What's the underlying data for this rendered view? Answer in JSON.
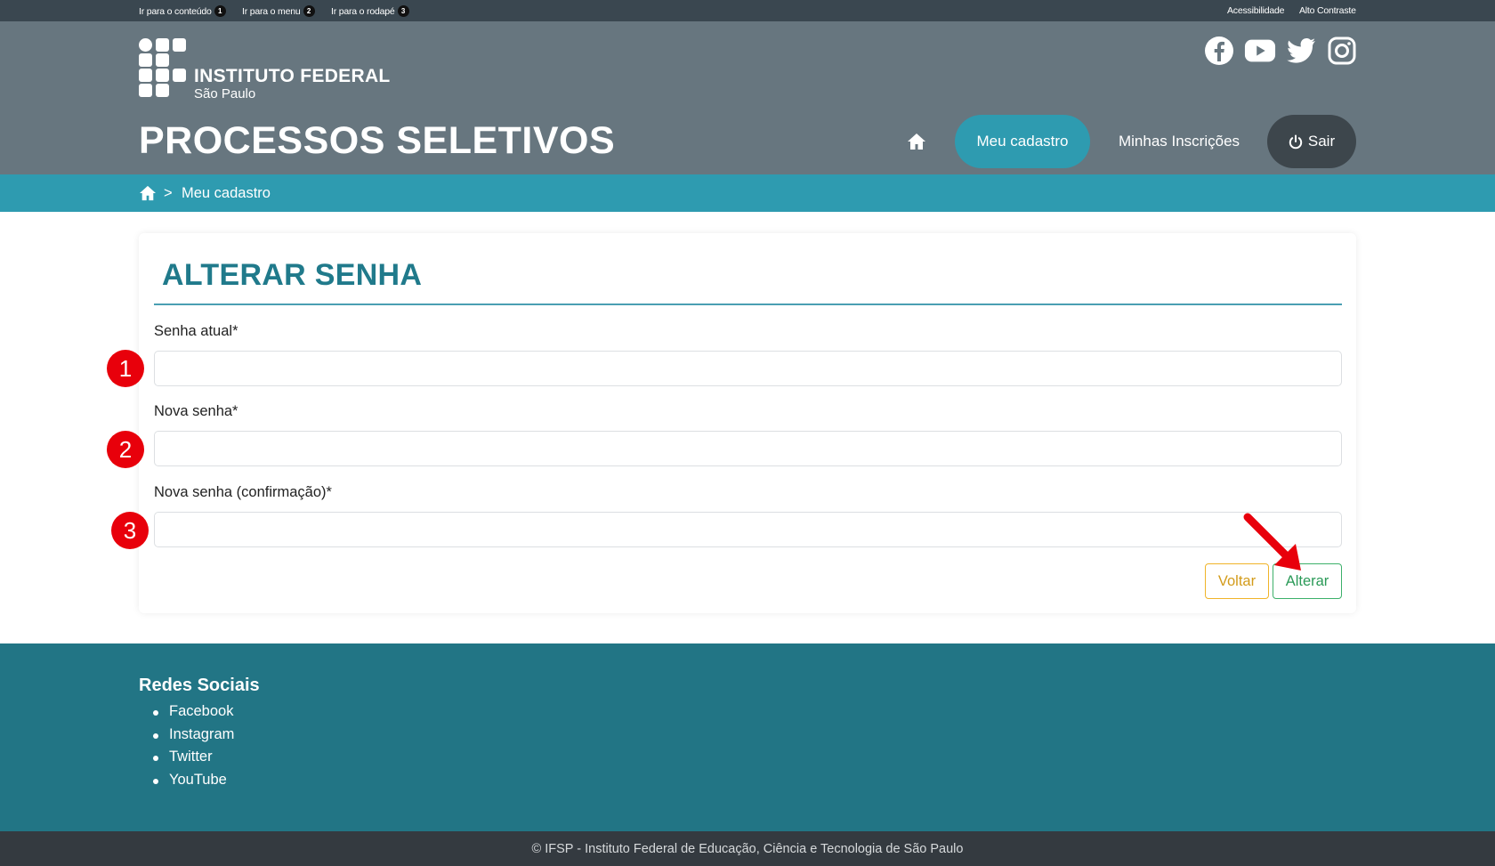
{
  "topbar": {
    "skip_links": [
      {
        "label": "Ir para o conteúdo",
        "key": "1"
      },
      {
        "label": "Ir para o menu",
        "key": "2"
      },
      {
        "label": "Ir para o rodapé",
        "key": "3"
      }
    ],
    "accessibility_label": "Acessibilidade",
    "contrast_label": "Alto Contraste"
  },
  "header": {
    "institution_name": "INSTITUTO FEDERAL",
    "institution_campus": "São Paulo",
    "site_title": "PROCESSOS SELETIVOS",
    "social_icons": [
      "facebook-icon",
      "youtube-icon",
      "twitter-icon",
      "instagram-icon"
    ],
    "nav": {
      "home_icon": "home-icon",
      "items": [
        "Meu cadastro",
        "Minhas Inscrições"
      ],
      "active": "Meu cadastro",
      "logout_label": "Sair",
      "logout_icon": "power-icon"
    }
  },
  "breadcrumb": {
    "home_icon": "home-icon",
    "separator": ">",
    "current": "Meu cadastro"
  },
  "form": {
    "title": "ALTERAR SENHA",
    "fields": [
      {
        "label": "Senha atual*",
        "value": "",
        "marker": "1"
      },
      {
        "label": "Nova senha*",
        "value": "",
        "marker": "2"
      },
      {
        "label": "Nova senha (confirmação)*",
        "value": "",
        "marker": "3"
      }
    ],
    "back_button": "Voltar",
    "submit_button": "Alterar"
  },
  "footer": {
    "title": "Redes Sociais",
    "links": [
      "Facebook",
      "Instagram",
      "Twitter",
      "YouTube"
    ],
    "copyright": "© IFSP - Instituto Federal de Educação, Ciência e Tecnologia de São Paulo"
  },
  "colors": {
    "header_bg": "#67767f",
    "accent": "#2e9bb0",
    "footer_bg": "#227585",
    "title_color": "#207a8b",
    "marker_red": "#e8000b",
    "back_button": "#f0b429",
    "submit_button": "#3cb06a"
  }
}
